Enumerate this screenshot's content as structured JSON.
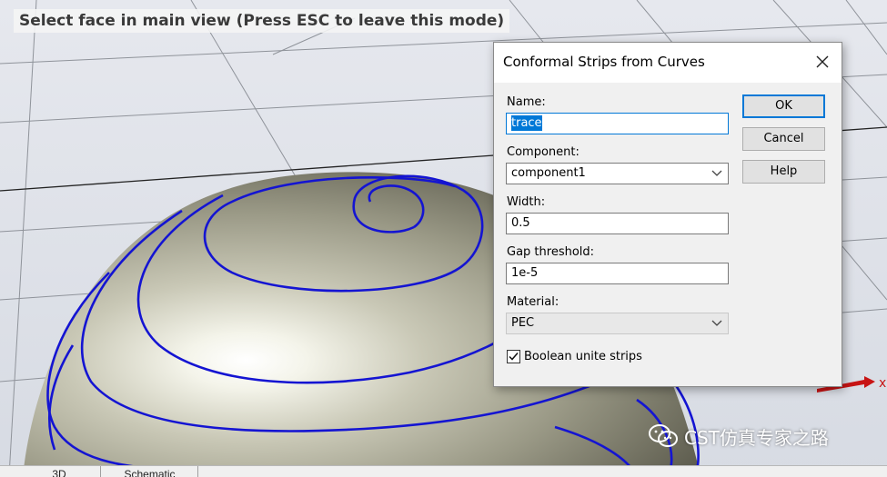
{
  "mode_banner": "Select face in main view (Press ESC to leave this mode)",
  "dialog": {
    "title": "Conformal Strips from Curves",
    "close_icon": "close-icon",
    "name_label": "Name:",
    "name_value": "trace",
    "component_label": "Component:",
    "component_value": "component1",
    "width_label": "Width:",
    "width_value": "0.5",
    "gap_label": "Gap threshold:",
    "gap_value": "1e-5",
    "material_label": "Material:",
    "material_value": "PEC",
    "boolean_label": "Boolean unite strips",
    "boolean_checked": true,
    "ok_label": "OK",
    "cancel_label": "Cancel",
    "help_label": "Help"
  },
  "tabs": [
    {
      "label": "3D"
    },
    {
      "label": "Schematic"
    }
  ],
  "watermark": {
    "icon": "wechat-icon",
    "text": "CST仿真专家之路"
  },
  "colors": {
    "curve": "#1414d2",
    "selection": "#0078d7",
    "axis_arrow": "#c81414"
  }
}
